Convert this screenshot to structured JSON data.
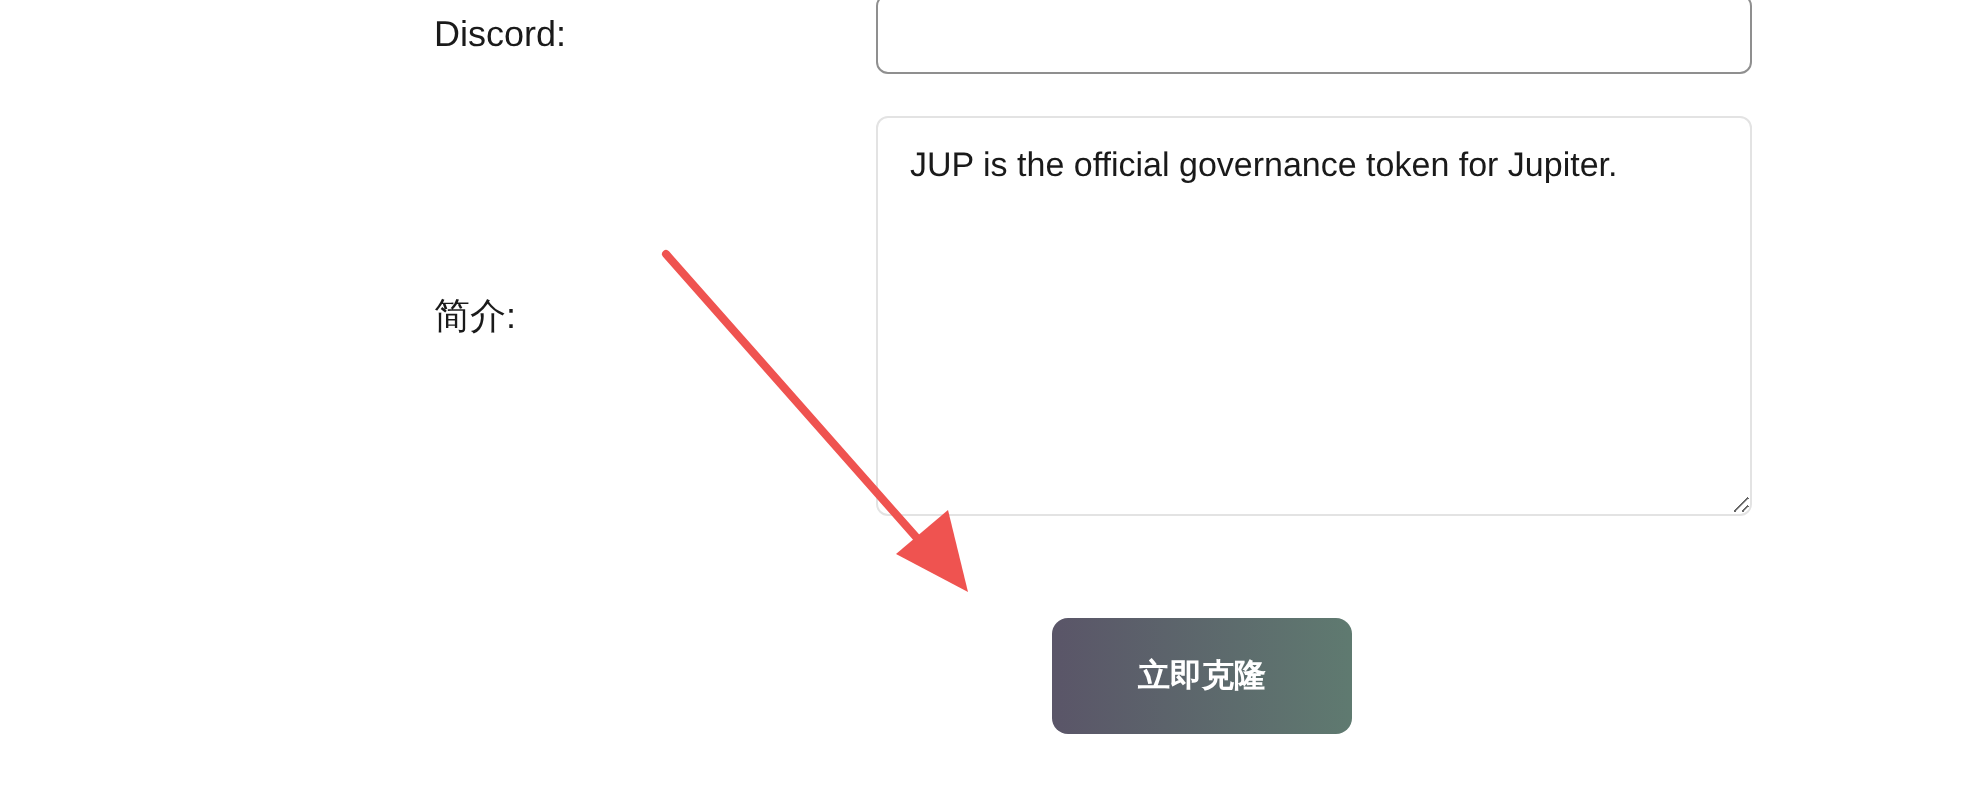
{
  "form": {
    "fields": [
      {
        "kind": "input",
        "label": "Discord:"
      },
      {
        "kind": "textarea",
        "label": "简介:",
        "value": "JUP is the official governance token for Jupiter."
      }
    ],
    "submit_button": "立即克隆"
  }
}
